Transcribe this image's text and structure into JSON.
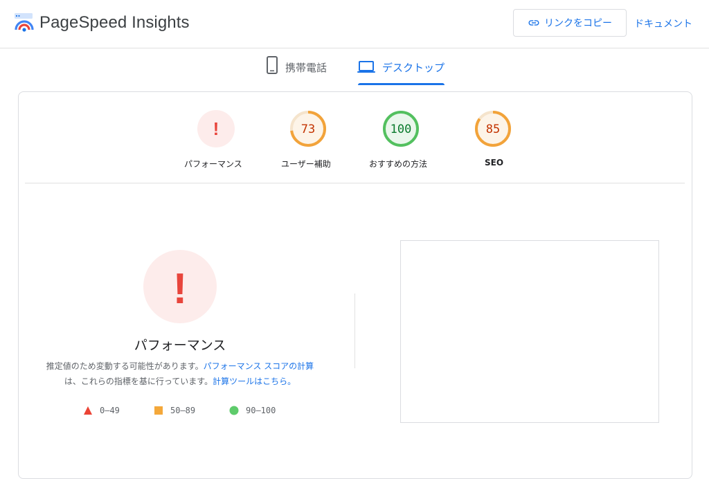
{
  "header": {
    "brand": "PageSpeed Insights",
    "copy_link_label": "リンクをコピー",
    "docs_label": "ドキュメント"
  },
  "tabs": [
    {
      "label": "携帯電話",
      "icon": "smartphone-icon",
      "active": false
    },
    {
      "label": "デスクトップ",
      "icon": "laptop-icon",
      "active": true
    }
  ],
  "scores": [
    {
      "label": "パフォーマンス",
      "value": "!",
      "status": "error"
    },
    {
      "label": "ユーザー補助",
      "value": "73",
      "status": "average"
    },
    {
      "label": "おすすめの方法",
      "value": "100",
      "status": "pass"
    },
    {
      "label": "SEO",
      "value": "85",
      "status": "average"
    }
  ],
  "performance": {
    "gauge_value": "!",
    "title": "パフォーマンス",
    "desc_prefix": "推定値のため変動する可能性があります。",
    "desc_link1": "パフォーマンス スコアの計算",
    "desc_middle": "は、これらの指標を基に行っています。",
    "desc_link2": "計算ツールはこちら。"
  },
  "legend": [
    {
      "range": "0–49",
      "shape": "triangle",
      "color": "#eb4335"
    },
    {
      "range": "50–89",
      "shape": "square",
      "color": "#f4a83a"
    },
    {
      "range": "90–100",
      "shape": "circle",
      "color": "#5ecb6b"
    }
  ],
  "colors": {
    "accent": "#1a73e8",
    "fail": "#e8453c",
    "fail_bg": "#fdeceb",
    "average": "#f2a33a",
    "average_text": "#c33300",
    "average_bg": "#fdf4e8",
    "pass": "#53c05f",
    "pass_text": "#0a7a2c",
    "pass_bg": "#eaf7ec"
  }
}
